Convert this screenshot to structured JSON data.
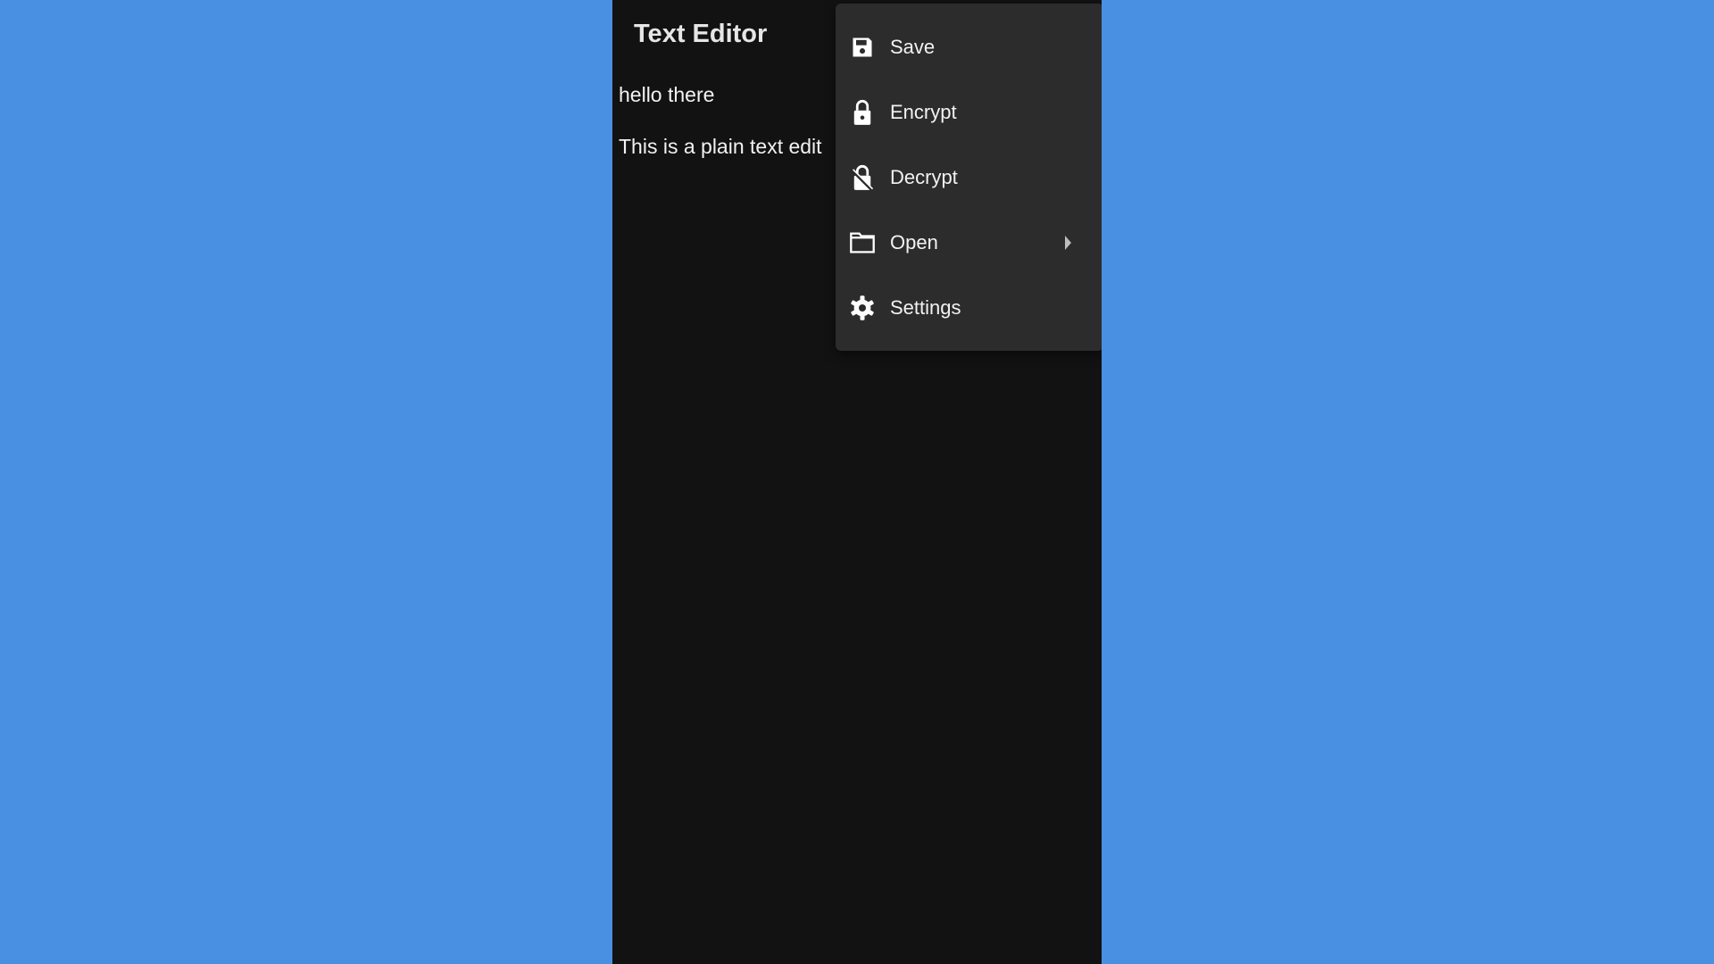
{
  "app": {
    "title": "Text Editor"
  },
  "editor": {
    "lines": [
      "hello there",
      "This is a plain text edit"
    ]
  },
  "menu": {
    "items": [
      {
        "label": "Save",
        "icon": "save-icon"
      },
      {
        "label": "Encrypt",
        "icon": "lock-icon"
      },
      {
        "label": "Decrypt",
        "icon": "unlock-icon"
      },
      {
        "label": "Open",
        "icon": "folder-icon",
        "submenu": true
      },
      {
        "label": "Settings",
        "icon": "gear-icon"
      }
    ]
  },
  "colors": {
    "background": "#4a90e2",
    "app_bg": "#121212",
    "menu_bg": "#2c2c2c"
  }
}
